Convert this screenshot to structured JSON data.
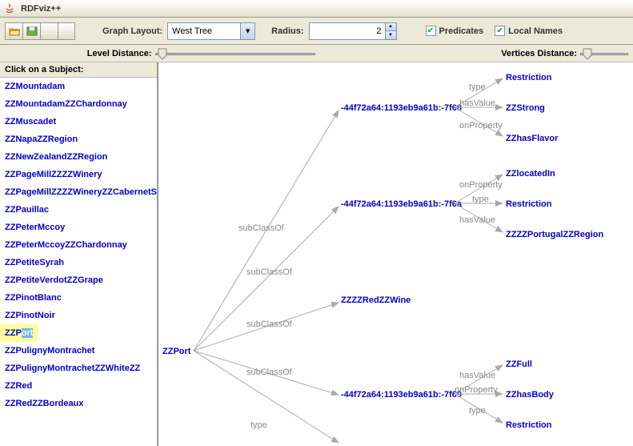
{
  "window": {
    "title": "RDFviz++"
  },
  "toolbar": {
    "graphLayoutLabel": "Graph Layout:",
    "graphLayoutValue": "West Tree",
    "radiusLabel": "Radius:",
    "radiusValue": "2",
    "predicatesLabel": "Predicates",
    "localNamesLabel": "Local Names"
  },
  "sliders": {
    "levelDistanceLabel": "Level Distance:",
    "verticesDistanceLabel": "Vertices Distance:"
  },
  "sidebar": {
    "title": "Click on a Subject:",
    "items": [
      "ZZMountadam",
      "ZZMountadamZZChardonnay",
      "ZZMuscadet",
      "ZZNapaZZRegion",
      "ZZNewZealandZZRegion",
      "ZZPageMillZZZZWinery",
      "ZZPageMillZZZZWineryZZCabernetSauvignon",
      "ZZPauillac",
      "ZZPeterMccoy",
      "ZZPeterMccoyZZChardonnay",
      "ZZPetiteSyrah",
      "ZZPetiteVerdotZZGrape",
      "ZZPinotBlanc",
      "ZZPinotNoir",
      "ZZPort",
      "ZZPulignyMontrachet",
      "ZZPulignyMontrachetZZWhiteZZ",
      "ZZRed",
      "ZZRedZZBordeaux"
    ],
    "selectedIndex": 14,
    "highlightPrefix": "ZZP",
    "highlightHl": "ort"
  },
  "graph": {
    "root": "ZZPort",
    "edges": {
      "subClassOf": "subClassOf",
      "type": "type",
      "hasValue": "hasValue",
      "onProperty": "onProperty"
    },
    "nodes": {
      "anon1": "-44f72a64:1193eb9a61b:-7f68",
      "anon2": "-44f72a64:1193eb9a61b:-7f6a",
      "anon3": "-44f72a64:1193eb9a61b:-7f69",
      "redWine": "ZZZZRedZZWine",
      "restriction": "Restriction",
      "zzStrong": "ZZStrong",
      "zzHasFlavor": "ZZhasFlavor",
      "zzLocatedIn": "ZZlocatedIn",
      "zzPortugal": "ZZZZPortugalZZRegion",
      "zzFull": "ZZFull",
      "zzHasBody": "ZZhasBody"
    }
  }
}
